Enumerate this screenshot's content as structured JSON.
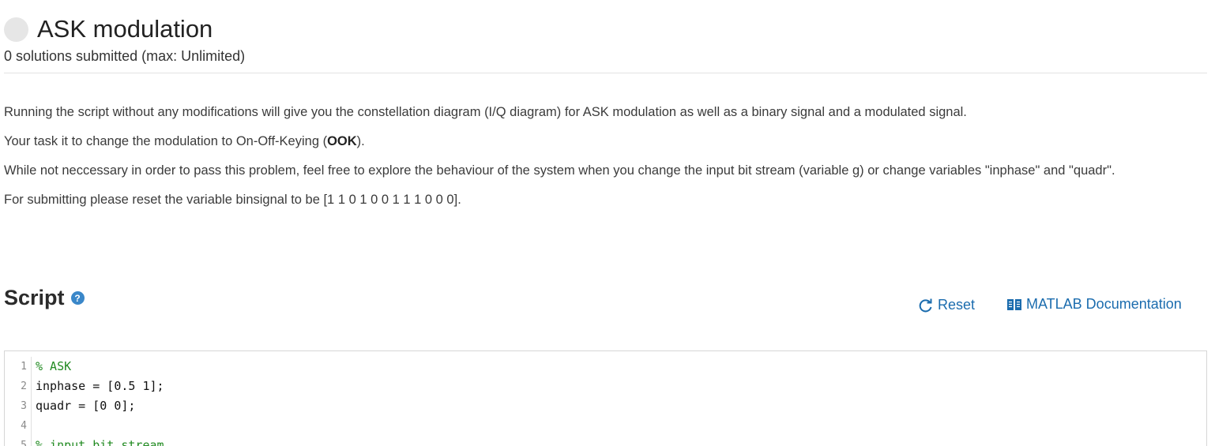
{
  "problem": {
    "title": "ASK modulation",
    "submissions": "0 solutions submitted (max: Unlimited)"
  },
  "description": {
    "p1": "Running the script without any modifications will give you the constellation diagram (I/Q diagram) for ASK modulation as well as a binary signal and a modulated signal.",
    "p2_before": "Your task it to change the modulation to On-Off-Keying (",
    "p2_bold": "OOK",
    "p2_after": ").",
    "p3": "While not neccessary in order to pass this problem, feel free to explore the behaviour of the system when you change the input bit stream (variable g) or change variables \"inphase\" and \"quadr\".",
    "p4": "For submitting please reset the variable binsignal to be [1 1 0 1 0 0 1 1 1 0 0 0]."
  },
  "script": {
    "heading": "Script",
    "help_glyph": "?",
    "reset_label": "Reset",
    "docs_label": "MATLAB Documentation",
    "lines": [
      {
        "num": "1",
        "text": "% ASK",
        "comment": true
      },
      {
        "num": "2",
        "text": "inphase = [0.5 1];",
        "comment": false
      },
      {
        "num": "3",
        "text": "quadr = [0 0];",
        "comment": false
      },
      {
        "num": "4",
        "text": "",
        "comment": false
      },
      {
        "num": "5",
        "text": "% input bit stream",
        "comment": true
      }
    ]
  },
  "icons": {
    "status": "status-circle-icon",
    "help": "help-icon",
    "reset": "refresh-icon",
    "docs": "book-icon"
  },
  "colors": {
    "link": "#1b6cae",
    "help_badge": "#3a87c9",
    "comment": "#228b22",
    "status_circle": "#e6e6e6"
  }
}
